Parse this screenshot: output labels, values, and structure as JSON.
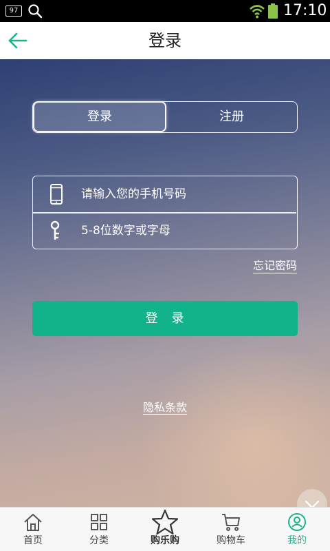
{
  "status_bar": {
    "notification_badge": "97",
    "time": "17:10"
  },
  "header": {
    "title": "登录",
    "back_icon": "arrow-left-icon"
  },
  "auth_tabs": [
    {
      "label": "登录",
      "selected": true
    },
    {
      "label": "注册",
      "selected": false
    }
  ],
  "form": {
    "phone": {
      "placeholder": "请输入您的手机号码",
      "icon": "phone-icon"
    },
    "password": {
      "placeholder": "5-8位数字或字母",
      "icon": "key-icon"
    }
  },
  "forgot_password": "忘记密码",
  "login_button": "登　录",
  "privacy_link": "隐私条款",
  "colors": {
    "accent": "#12b38a",
    "active_tab": "#1bb38b"
  },
  "bottom_nav": [
    {
      "label": "首页",
      "icon": "home-icon",
      "active": false
    },
    {
      "label": "分类",
      "icon": "grid-icon",
      "active": false
    },
    {
      "label": "购乐购",
      "icon": "star-icon",
      "active": false
    },
    {
      "label": "购物车",
      "icon": "cart-icon",
      "active": false
    },
    {
      "label": "我的",
      "icon": "user-icon",
      "active": true
    }
  ]
}
